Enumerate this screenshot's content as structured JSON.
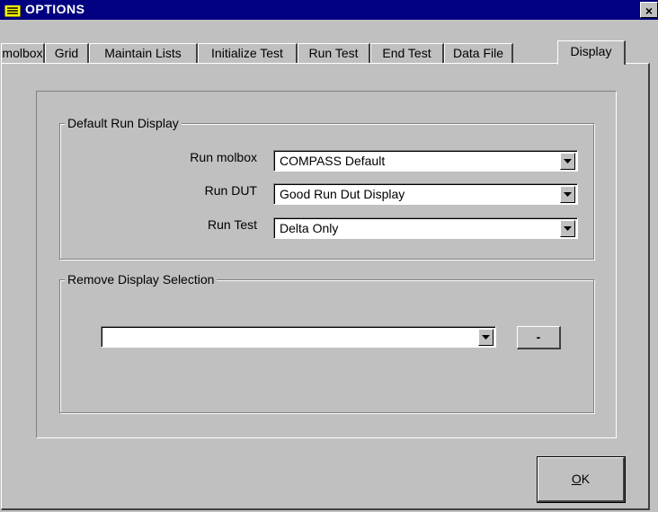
{
  "window": {
    "title": "OPTIONS",
    "close_label": "×",
    "title_bar_color": "#000080",
    "icon": "list-window-icon"
  },
  "tabs": [
    {
      "label": "molbox"
    },
    {
      "label": "Grid"
    },
    {
      "label": "Maintain Lists"
    },
    {
      "label": "Initialize Test"
    },
    {
      "label": "Run Test"
    },
    {
      "label": "End Test"
    },
    {
      "label": "Data File"
    },
    {
      "label": "Display",
      "selected": true
    }
  ],
  "default_run_display": {
    "legend": "Default Run Display",
    "rows": [
      {
        "label": "Run molbox",
        "value": "COMPASS Default"
      },
      {
        "label": "Run DUT",
        "value": "Good Run Dut Display"
      },
      {
        "label": "Run Test",
        "value": "Delta Only"
      }
    ]
  },
  "remove_display": {
    "legend": "Remove Display Selection",
    "value": "",
    "remove_button_label": "-"
  },
  "ok_button": {
    "mnemonic": "O",
    "rest": "K"
  }
}
